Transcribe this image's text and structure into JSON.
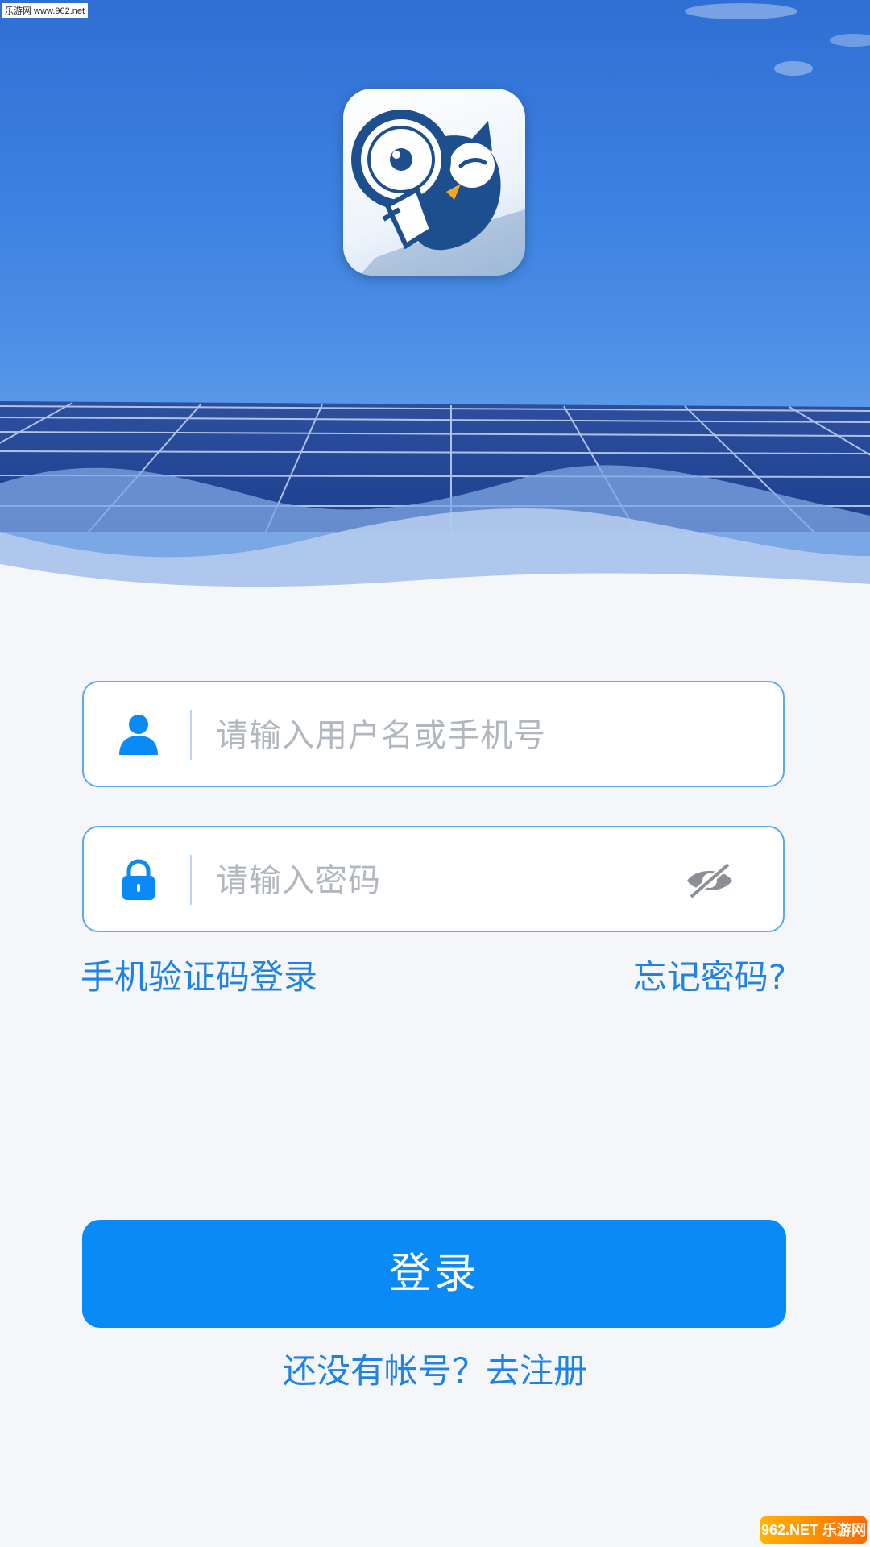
{
  "watermark": "乐游网 www.962.net",
  "username": {
    "placeholder": "请输入用户名或手机号"
  },
  "password": {
    "placeholder": "请输入密码"
  },
  "links": {
    "sms_login": "手机验证码登录",
    "forgot_password": "忘记密码?"
  },
  "login_button": "登录",
  "register_prompt": "还没有帐号？去注册",
  "site_badge": "962.NET 乐游网",
  "icons": {
    "app_logo": "owl-magnifier-logo",
    "user": "user-icon",
    "lock": "lock-icon",
    "eye_hidden": "eye-off-icon"
  },
  "colors": {
    "accent": "#0a8af7",
    "link": "#1f82e6",
    "field_border": "#5aa9ee",
    "placeholder": "#b2b7be",
    "background": "#f4f6f9"
  }
}
